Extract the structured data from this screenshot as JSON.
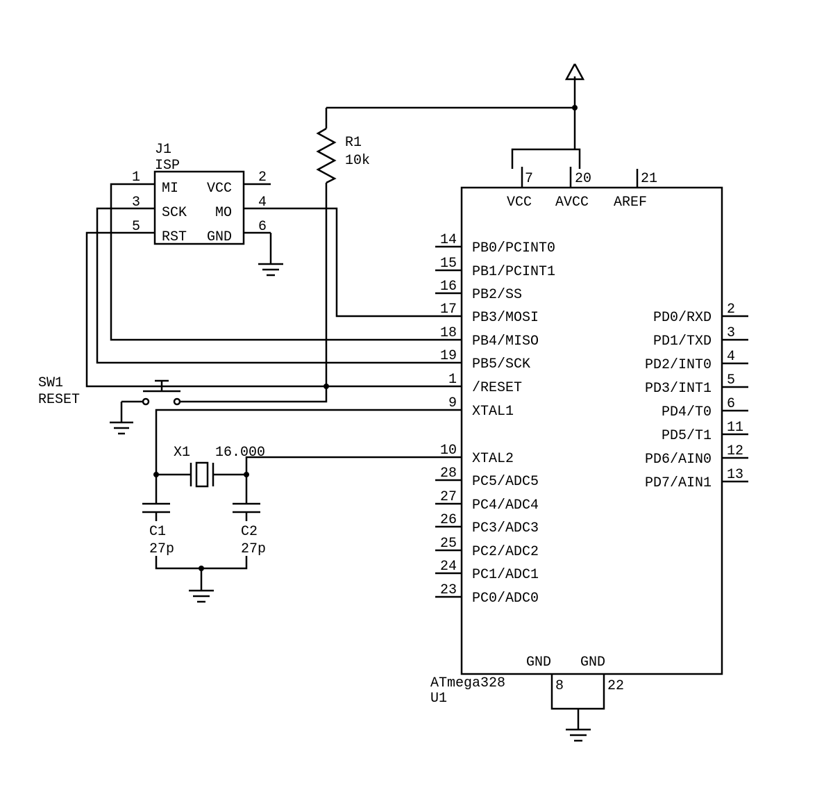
{
  "mcu": {
    "part": "ATmega328",
    "ref": "U1",
    "top_pins": [
      {
        "num": "7",
        "name": "VCC"
      },
      {
        "num": "20",
        "name": "AVCC"
      },
      {
        "num": "21",
        "name": "AREF"
      }
    ],
    "bottom_pins": [
      {
        "num": "8",
        "name": "GND"
      },
      {
        "num": "22",
        "name": "GND"
      }
    ],
    "left_pins": [
      {
        "num": "14",
        "name": "PB0/PCINT0"
      },
      {
        "num": "15",
        "name": "PB1/PCINT1"
      },
      {
        "num": "16",
        "name": "PB2/SS"
      },
      {
        "num": "17",
        "name": "PB3/MOSI"
      },
      {
        "num": "18",
        "name": "PB4/MISO"
      },
      {
        "num": "19",
        "name": "PB5/SCK"
      },
      {
        "num": "1",
        "name": "/RESET"
      },
      {
        "num": "9",
        "name": "XTAL1"
      },
      {
        "num": "",
        "name": ""
      },
      {
        "num": "10",
        "name": "XTAL2"
      },
      {
        "num": "28",
        "name": "PC5/ADC5"
      },
      {
        "num": "27",
        "name": "PC4/ADC4"
      },
      {
        "num": "26",
        "name": "PC3/ADC3"
      },
      {
        "num": "25",
        "name": "PC2/ADC2"
      },
      {
        "num": "24",
        "name": "PC1/ADC1"
      },
      {
        "num": "23",
        "name": "PC0/ADC0"
      }
    ],
    "right_pins": [
      {
        "num": "2",
        "name": "PD0/RXD"
      },
      {
        "num": "3",
        "name": "PD1/TXD"
      },
      {
        "num": "4",
        "name": "PD2/INT0"
      },
      {
        "num": "5",
        "name": "PD3/INT1"
      },
      {
        "num": "6",
        "name": "PD4/T0"
      },
      {
        "num": "11",
        "name": "PD5/T1"
      },
      {
        "num": "12",
        "name": "PD6/AIN0"
      },
      {
        "num": "13",
        "name": "PD7/AIN1"
      }
    ]
  },
  "isp": {
    "ref": "J1",
    "name": "ISP",
    "pins": [
      {
        "num": "1",
        "name": "MI"
      },
      {
        "num": "2",
        "name": "VCC"
      },
      {
        "num": "3",
        "name": "SCK"
      },
      {
        "num": "4",
        "name": "MO"
      },
      {
        "num": "5",
        "name": "RST"
      },
      {
        "num": "6",
        "name": "GND"
      }
    ]
  },
  "r1": {
    "ref": "R1",
    "value": "10k"
  },
  "xtal": {
    "ref": "X1",
    "value": "16.000"
  },
  "c1": {
    "ref": "C1",
    "value": "27p"
  },
  "c2": {
    "ref": "C2",
    "value": "27p"
  },
  "sw": {
    "ref": "SW1",
    "name": "RESET"
  }
}
